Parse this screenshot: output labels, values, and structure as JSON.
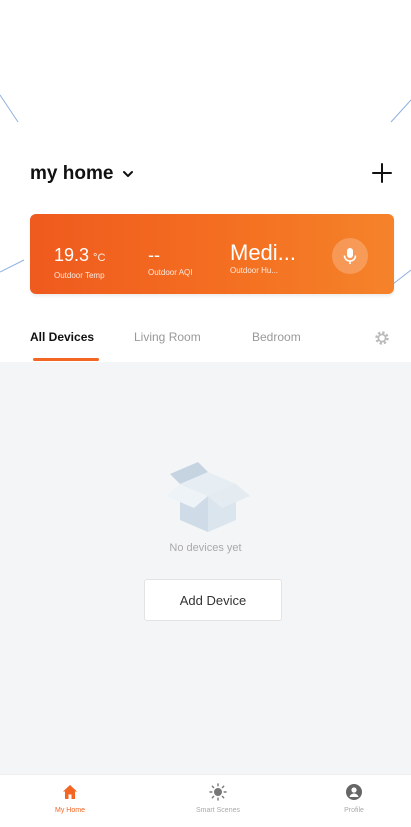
{
  "header": {
    "home_name": "my home"
  },
  "weather": {
    "temp_value": "19.3",
    "temp_unit": "°C",
    "temp_label": "Outdoor Temp",
    "aqi_value": "--",
    "aqi_label": "Outdoor AQI",
    "humidity_value": "Medi...",
    "humidity_label": "Outdoor Hu..."
  },
  "tabs": [
    {
      "label": "All Devices",
      "active": true
    },
    {
      "label": "Living Room",
      "active": false
    },
    {
      "label": "Bedroom",
      "active": false
    }
  ],
  "empty_state": {
    "message": "No devices yet",
    "button_label": "Add Device"
  },
  "nav": [
    {
      "label": "My Home",
      "icon": "home-icon",
      "active": true
    },
    {
      "label": "Smart Scenes",
      "icon": "sun-icon",
      "active": false
    },
    {
      "label": "Profile",
      "icon": "profile-icon",
      "active": false
    }
  ],
  "colors": {
    "accent": "#f26522",
    "card_gradient_start": "#ef5a1e",
    "card_gradient_end": "#f5832a",
    "leader_lines": "#8fb0e0"
  }
}
